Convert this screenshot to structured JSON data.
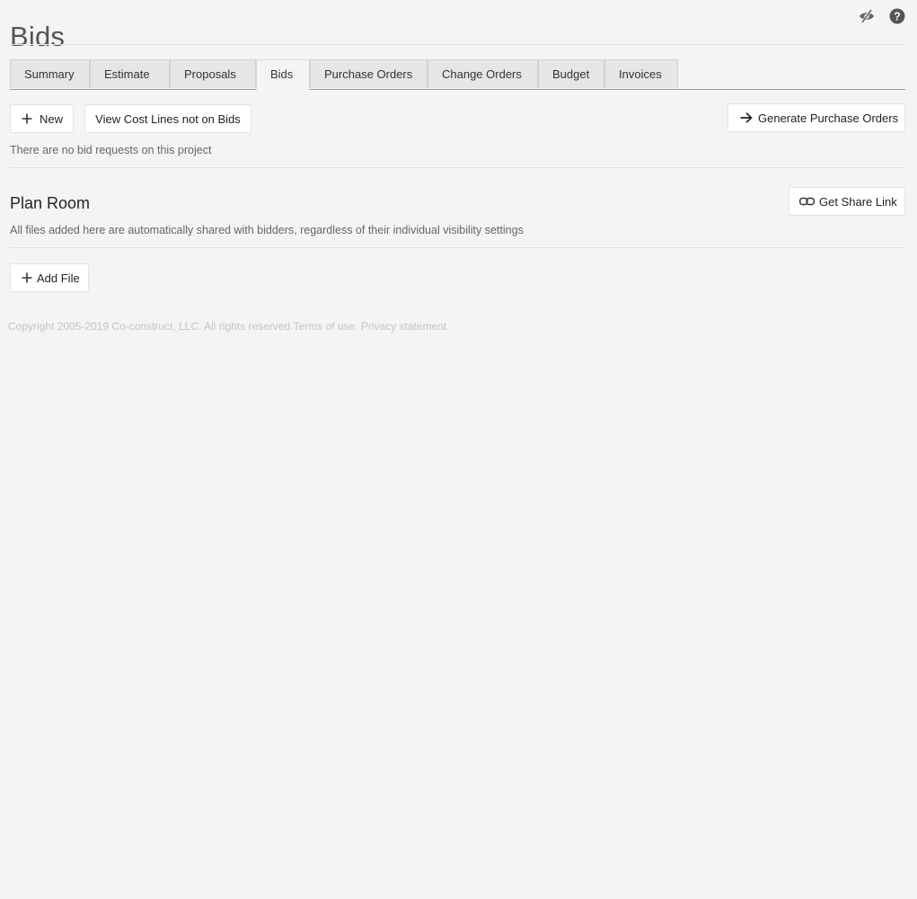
{
  "page": {
    "title": "Bids"
  },
  "header_icons": [
    {
      "name": "visibility-off-icon"
    },
    {
      "name": "help-icon"
    }
  ],
  "tabs": [
    {
      "label": "Summary"
    },
    {
      "label": "Estimate"
    },
    {
      "label": "Proposals"
    },
    {
      "label": "Bids",
      "active": true
    },
    {
      "label": "Purchase Orders"
    },
    {
      "label": "Change Orders"
    },
    {
      "label": "Budget"
    },
    {
      "label": "Invoices"
    }
  ],
  "toolbar": {
    "new_label": "New",
    "new_icon": "plus-icon",
    "view_cost_lines_label": "View Cost Lines not on Bids",
    "generate_po_label": "Generate Purchase Orders",
    "generate_po_icon": "arrow-right-icon"
  },
  "bids": {
    "empty_message": "There are no bid requests on this project"
  },
  "plan_room": {
    "title": "Plan Room",
    "share_link_label": "Get Share Link",
    "share_link_icon": "link-icon",
    "description": "All files added here are automatically shared with bidders, regardless of their individual visibility settings",
    "add_file_label": "Add File",
    "add_file_icon": "plus-icon"
  },
  "footer": {
    "copyright": "Copyright 2005-2019 Co-construct, LLC. All rights reserved.",
    "terms_label": "Terms of use.",
    "privacy_label": "Privacy statement."
  },
  "colors": {
    "background": "#f4f4f4",
    "tab_inactive": "#e6e6e6",
    "button_bg": "#ffffff",
    "muted_text": "#666666",
    "footer_text": "#c4c4c4"
  }
}
